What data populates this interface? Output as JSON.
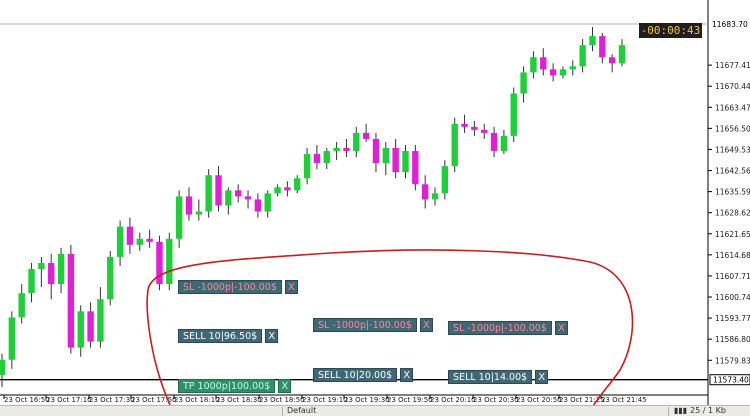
{
  "chart_data": {
    "type": "candlestick",
    "symbol_price_label": "11683.70",
    "countdown": "-00:00:43",
    "current_price_line_label": "11573.40",
    "y_ticks": [
      "11677.41",
      "11670.44",
      "11663.47",
      "11656.50",
      "11649.53",
      "11642.56",
      "11635.59",
      "11628.62",
      "11621.65",
      "11614.68",
      "11607.71",
      "11600.74",
      "11593.77",
      "11586.80",
      "11579.83"
    ],
    "x_ticks": [
      "23 Oct 16:50",
      "23 Oct 17:10",
      "23 Oct 17:30",
      "23 Oct 17:50",
      "23 Oct 18:10",
      "23 Oct 18:30",
      "23 Oct 18:50",
      "23 Oct 19:10",
      "23 Oct 19:30",
      "23 Oct 19:50",
      "23 Oct 20:10",
      "23 Oct 20:30",
      "23 Oct 20:50",
      "23 Oct 21:25",
      "23 Oct 21:45"
    ],
    "ylim": [
      11570.0,
      11691.0
    ],
    "candles": [
      [
        11575.0,
        11582.0,
        11571.0,
        11580.0
      ],
      [
        11580.0,
        11596.0,
        11577.0,
        11594.0
      ],
      [
        11594.0,
        11605.0,
        11592.0,
        11602.0
      ],
      [
        11602.0,
        11612.0,
        11599.0,
        11610.0
      ],
      [
        11610.0,
        11614.0,
        11604.0,
        11612.0
      ],
      [
        11612.0,
        11615.0,
        11600.0,
        11605.0
      ],
      [
        11605.0,
        11617.0,
        11602.0,
        11615.0
      ],
      [
        11615.0,
        11618.0,
        11582.0,
        11584.0
      ],
      [
        11584.0,
        11598.0,
        11581.0,
        11596.0
      ],
      [
        11596.0,
        11599.0,
        11584.0,
        11586.0
      ],
      [
        11586.0,
        11604.0,
        11584.0,
        11600.0
      ],
      [
        11600.0,
        11616.0,
        11598.0,
        11614.0
      ],
      [
        11614.0,
        11626.0,
        11611.0,
        11624.0
      ],
      [
        11624.0,
        11627.0,
        11615.0,
        11618.0
      ],
      [
        11618.0,
        11622.0,
        11616.0,
        11620.0
      ],
      [
        11620.0,
        11623.0,
        11617.0,
        11619.0
      ],
      [
        11619.0,
        11621.0,
        11603.0,
        11605.0
      ],
      [
        11605.0,
        11622.0,
        11603.0,
        11620.0
      ],
      [
        11620.0,
        11636.0,
        11617.0,
        11634.0
      ],
      [
        11634.0,
        11637.0,
        11626.0,
        11628.0
      ],
      [
        11628.0,
        11633.0,
        11626.0,
        11629.0
      ],
      [
        11629.0,
        11643.0,
        11627.0,
        11641.0
      ],
      [
        11641.0,
        11644.0,
        11629.0,
        11631.0
      ],
      [
        11631.0,
        11637.0,
        11628.0,
        11636.0
      ],
      [
        11636.0,
        11638.0,
        11632.0,
        11634.0
      ],
      [
        11634.0,
        11636.0,
        11630.0,
        11633.0
      ],
      [
        11633.0,
        11635.0,
        11627.0,
        11629.0
      ],
      [
        11629.0,
        11636.0,
        11627.0,
        11635.0
      ],
      [
        11635.0,
        11638.0,
        11634.0,
        11637.0
      ],
      [
        11637.0,
        11639.0,
        11634.0,
        11636.0
      ],
      [
        11636.0,
        11641.0,
        11635.0,
        11640.0
      ],
      [
        11640.0,
        11650.0,
        11638.0,
        11648.0
      ],
      [
        11648.0,
        11651.0,
        11643.0,
        11645.0
      ],
      [
        11645.0,
        11650.0,
        11643.0,
        11649.0
      ],
      [
        11649.0,
        11652.0,
        11646.0,
        11650.0
      ],
      [
        11650.0,
        11653.0,
        11647.0,
        11649.0
      ],
      [
        11649.0,
        11657.0,
        11647.0,
        11655.0
      ],
      [
        11655.0,
        11658.0,
        11652.0,
        11653.0
      ],
      [
        11653.0,
        11655.0,
        11642.0,
        11645.0
      ],
      [
        11645.0,
        11652.0,
        11641.0,
        11650.0
      ],
      [
        11650.0,
        11653.0,
        11640.0,
        11642.0
      ],
      [
        11642.0,
        11651.0,
        11640.0,
        11649.0
      ],
      [
        11649.0,
        11651.0,
        11636.0,
        11638.0
      ],
      [
        11638.0,
        11641.0,
        11630.0,
        11633.0
      ],
      [
        11633.0,
        11637.0,
        11631.0,
        11635.0
      ],
      [
        11635.0,
        11646.0,
        11633.0,
        11644.0
      ],
      [
        11644.0,
        11660.0,
        11642.0,
        11658.0
      ],
      [
        11658.0,
        11661.0,
        11655.0,
        11657.0
      ],
      [
        11657.0,
        11659.0,
        11654.0,
        11656.0
      ],
      [
        11656.0,
        11658.0,
        11653.0,
        11655.0
      ],
      [
        11655.0,
        11657.0,
        11647.0,
        11649.0
      ],
      [
        11649.0,
        11656.0,
        11648.0,
        11654.0
      ],
      [
        11654.0,
        11670.0,
        11652.0,
        11668.0
      ],
      [
        11668.0,
        11677.0,
        11665.0,
        11675.0
      ],
      [
        11675.0,
        11682.0,
        11673.0,
        11680.0
      ],
      [
        11680.0,
        11683.0,
        11674.0,
        11676.0
      ],
      [
        11676.0,
        11678.0,
        11672.0,
        11674.0
      ],
      [
        11674.0,
        11677.0,
        11673.0,
        11676.0
      ],
      [
        11676.0,
        11679.0,
        11674.0,
        11677.0
      ],
      [
        11677.0,
        11686.0,
        11675.0,
        11684.0
      ],
      [
        11684.0,
        11690.0,
        11682.0,
        11687.0
      ],
      [
        11687.0,
        11688.0,
        11678.0,
        11680.0
      ],
      [
        11680.0,
        11681.0,
        11675.0,
        11678.0
      ],
      [
        11678.0,
        11686.0,
        11677.0,
        11684.0
      ]
    ]
  },
  "orders": [
    {
      "label": "SL -1000p|-100.00$",
      "close": "X"
    },
    {
      "label": "SL -1000p|-100.00$",
      "close": "X"
    },
    {
      "label": "SL -1000p|-100.00$",
      "close": "X"
    },
    {
      "label": "SELL 10|96.50$",
      "close": "X"
    },
    {
      "label": "SELL 10|20.00$",
      "close": "X"
    },
    {
      "label": "SELL 10|14.00$",
      "close": "X"
    },
    {
      "label": "TP 1000p|100.00$",
      "close": "X"
    }
  ],
  "statusbar": {
    "profile": "Default",
    "connection": "25 / 1 Kb"
  },
  "colors": {
    "bull": "#1ecf3a",
    "bear": "#e020d4",
    "annotation": "#c81e1e"
  }
}
